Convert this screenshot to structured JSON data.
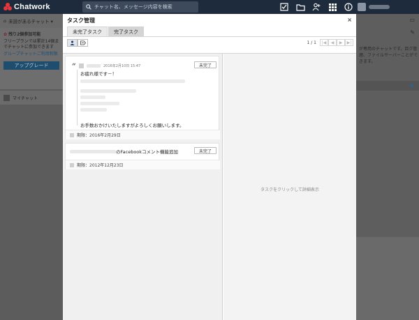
{
  "app": {
    "name": "Chatwork"
  },
  "search": {
    "placeholder": "チャット名、メッセージ内容を検索"
  },
  "top_icons": [
    "task-check-icon",
    "folder-icon",
    "add-contact-icon",
    "apps-grid-icon",
    "info-icon"
  ],
  "sidebar": {
    "filter_label": "未読があるチャット ▾",
    "banner_title": "残り2個参加可能",
    "banner_text": "フリープランでは累計14個までチャットに参加できます",
    "banner_link": "グループチャットご利用制限",
    "upgrade_label": "アップグレード",
    "mychat_label": "マイチャット"
  },
  "right_panel": {
    "text": "が専用のチャットです。目ク管理、ファイルサーバーことができます。"
  },
  "dialog": {
    "title": "タスク管理",
    "close": "×",
    "tabs": [
      {
        "label": "未完了タスク",
        "active": false
      },
      {
        "label": "完了タスク",
        "active": true
      }
    ],
    "pager": {
      "count": "1 / 1",
      "first": "|◀",
      "prev": "◀",
      "next": "▶",
      "last": "▶|"
    },
    "detail_hint": "タスクをクリックして詳細表示",
    "tasks": [
      {
        "date": "2016年2月10日 15:47",
        "button": "未完了",
        "greeting": "お疲れ様です－！",
        "closing": "お手数おかけいたしますがよろしくお願いします。",
        "due": "期限：2016年2月29日"
      },
      {
        "title_suffix": "のFacebookコメント機能追加",
        "button": "未完了",
        "due": "期限：2012年12月23日"
      }
    ]
  }
}
